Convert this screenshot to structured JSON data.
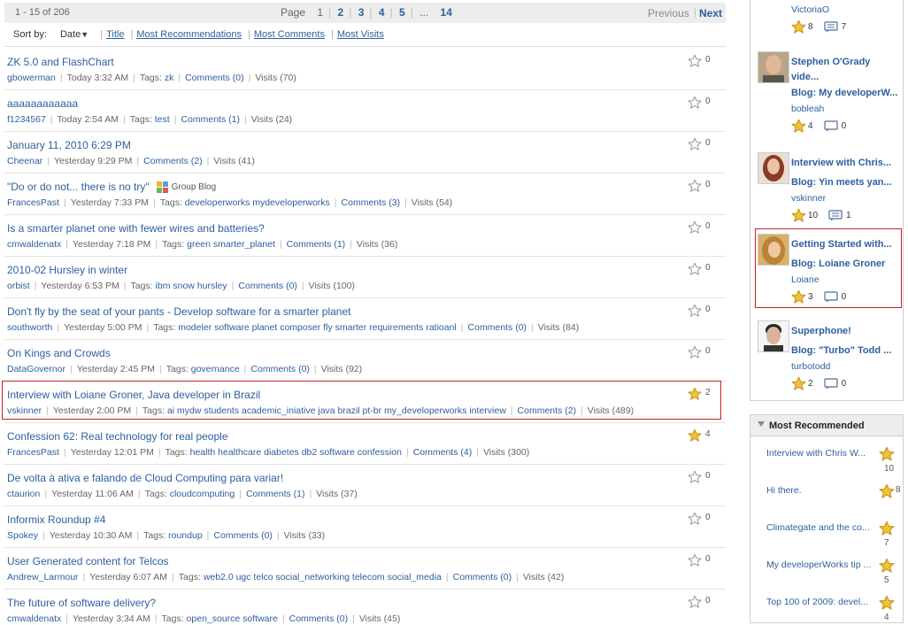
{
  "pager": {
    "count": "1 - 15 of 206",
    "page_label": "Page",
    "current": "1",
    "pages": [
      "2",
      "3",
      "4",
      "5"
    ],
    "ellipsis": "...",
    "last": "14",
    "previous": "Previous",
    "next": "Next"
  },
  "sort": {
    "label": "Sort by:",
    "selected": "Date",
    "options": [
      "Title",
      "Most Recommendations",
      "Most Comments",
      "Most Visits"
    ]
  },
  "entries": [
    {
      "title": "ZK 5.0 and FlashChart",
      "author": "gbowerman",
      "time": "Today 3:32 AM",
      "tags": "zk",
      "comments": "Comments (0)",
      "visits": "Visits (70)",
      "rec": "0",
      "starred": false
    },
    {
      "title": "aaaaaaaaaaaa",
      "author": "f1234567",
      "time": "Today 2:54 AM",
      "tags": "test",
      "comments": "Comments (1)",
      "visits": "Visits (24)",
      "rec": "0",
      "starred": false
    },
    {
      "title": "January 11, 2010 6:29 PM",
      "author": "Cheenar",
      "time": "Yesterday 9:29 PM",
      "tags": "",
      "comments": "Comments (2)",
      "visits": "Visits (41)",
      "rec": "0",
      "starred": false
    },
    {
      "title": "\"Do or do not... there is no try\"",
      "group": "Group Blog",
      "author": "FrancesPast",
      "time": "Yesterday 7:33 PM",
      "tags": "developerworks mydeveloperworks",
      "comments": "Comments (3)",
      "visits": "Visits (54)",
      "rec": "0",
      "starred": false
    },
    {
      "title": "Is a smarter planet one with fewer wires and batteries?",
      "author": "cmwaldenatx",
      "time": "Yesterday 7:18 PM",
      "tags": "green smarter_planet",
      "comments": "Comments (1)",
      "visits": "Visits (36)",
      "rec": "0",
      "starred": false
    },
    {
      "title": "2010-02 Hursley in winter",
      "author": "orbist",
      "time": "Yesterday 6:53 PM",
      "tags": "ibm snow hursley",
      "comments": "Comments (0)",
      "visits": "Visits (100)",
      "rec": "0",
      "starred": false
    },
    {
      "title": "Don't fly by the seat of your pants - Develop software for a smarter planet",
      "author": "southworth",
      "time": "Yesterday 5:00 PM",
      "tags": "modeler software planet composer fly smarter requirements ratioanl",
      "comments": "Comments (0)",
      "visits": "Visits (84)",
      "rec": "0",
      "starred": false
    },
    {
      "title": "On Kings and Crowds",
      "author": "DataGovernor",
      "time": "Yesterday 2:45 PM",
      "tags": "governance",
      "comments": "Comments (0)",
      "visits": "Visits (92)",
      "rec": "0",
      "starred": false
    },
    {
      "title": "Interview with Loiane Groner, Java developer in Brazil",
      "author": "vskinner",
      "time": "Yesterday 2:00 PM",
      "tags": "ai mydw students academic_iniative java brazil pt-br my_developerworks interview",
      "comments": "Comments (2)",
      "visits": "Visits (489)",
      "rec": "2",
      "starred": true,
      "highlight": true
    },
    {
      "title": "Confession 62: Real technology for real people",
      "author": "FrancesPast",
      "time": "Yesterday 12:01 PM",
      "tags": "health healthcare diabetes db2 software confession",
      "comments": "Comments (4)",
      "visits": "Visits (300)",
      "rec": "4",
      "starred": true
    },
    {
      "title": "De volta à ativa e falando de Cloud Computing para variar!",
      "author": "ctaurion",
      "time": "Yesterday 11:06 AM",
      "tags": "cloudcomputing",
      "comments": "Comments (1)",
      "visits": "Visits (37)",
      "rec": "0",
      "starred": false
    },
    {
      "title": "Informix Roundup #4",
      "author": "Spokey",
      "time": "Yesterday 10:30 AM",
      "tags": "roundup",
      "comments": "Comments (0)",
      "visits": "Visits (33)",
      "rec": "0",
      "starred": false
    },
    {
      "title": "User Generated content for Telcos",
      "author": "Andrew_Larmour",
      "time": "Yesterday 6:07 AM",
      "tags": "web2.0 ugc telco social_networking telecom social_media",
      "comments": "Comments (0)",
      "visits": "Visits (42)",
      "rec": "0",
      "starred": false
    },
    {
      "title": "The future of software delivery?",
      "author": "cmwaldenatx",
      "time": "Yesterday 3:34 AM",
      "tags": "open_source software",
      "comments": "Comments (0)",
      "visits": "Visits (45)",
      "rec": "0",
      "starred": false
    }
  ],
  "tags_label": "Tags:",
  "side_cards": [
    {
      "title": "",
      "title2": "",
      "blog": "",
      "user": "VictoriaO",
      "rec": "8",
      "comments": "7",
      "avatar": "none"
    },
    {
      "title": "Stephen O'Grady",
      "title2": "vide...",
      "blog": "Blog:  My developerW...",
      "user": "bobleah",
      "rec": "4",
      "comments": "0",
      "avatar": "bald"
    },
    {
      "title": "Interview with Chris...",
      "title2": "",
      "blog": "Blog:  Yin meets yan...",
      "user": "vskinner",
      "rec": "10",
      "comments": "1",
      "avatar": "red"
    },
    {
      "title": "Getting Started with...",
      "title2": "",
      "blog": "Blog:  Loiane Groner",
      "user": "Loiane",
      "rec": "3",
      "comments": "0",
      "avatar": "blonde",
      "highlight": true
    },
    {
      "title": "Superphone!",
      "title2": "",
      "blog": "Blog:  \"Turbo\" Todd ...",
      "user": "turbotodd",
      "rec": "2",
      "comments": "0",
      "avatar": "dark"
    }
  ],
  "most_recommended": {
    "heading": "Most Recommended",
    "items": [
      {
        "title": "Interview with Chris W...",
        "count": "10"
      },
      {
        "title": "Hi there.",
        "count": "8"
      },
      {
        "title": "Climategate and the co...",
        "count": "7"
      },
      {
        "title": "My developerWorks tip ...",
        "count": "5"
      },
      {
        "title": "Top 100 of 2009: devel...",
        "count": "4"
      }
    ]
  },
  "colors": {
    "link": "#2d5f9e",
    "highlight": "#c0202a",
    "star_gold": "#f2c23a"
  }
}
